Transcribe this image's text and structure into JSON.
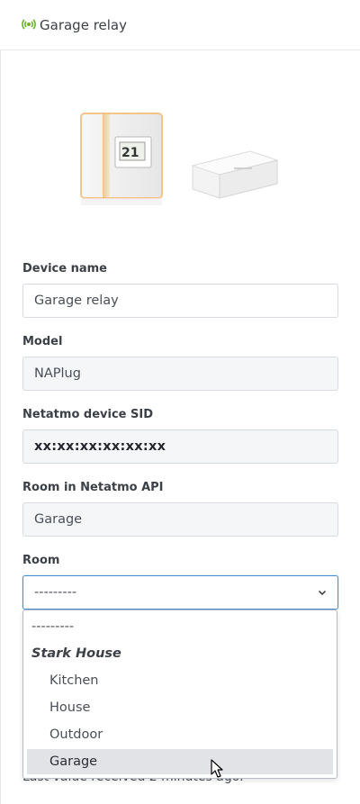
{
  "header": {
    "title": "Garage relay",
    "icon": "wifi-signal-icon",
    "icon_color": "#6bb52b"
  },
  "form": {
    "device_name": {
      "label": "Device name",
      "value": "Garage relay"
    },
    "model": {
      "label": "Model",
      "value": "NAPlug"
    },
    "sid": {
      "label": "Netatmo device SID",
      "value": "xx:xx:xx:xx:xx:xx"
    },
    "room_api": {
      "label": "Room in Netatmo API",
      "value": "Garage"
    },
    "room": {
      "label": "Room",
      "value": "---------"
    }
  },
  "dropdown": {
    "empty": "---------",
    "group": "Stark House",
    "options": [
      "Kitchen",
      "House",
      "Outdoor",
      "Garage"
    ],
    "selected": "Garage"
  },
  "status_text": "Last value received 2 minutes ago.",
  "colors": {
    "accent": "#4a90d9",
    "selected_bg": "#e2e3e7"
  }
}
